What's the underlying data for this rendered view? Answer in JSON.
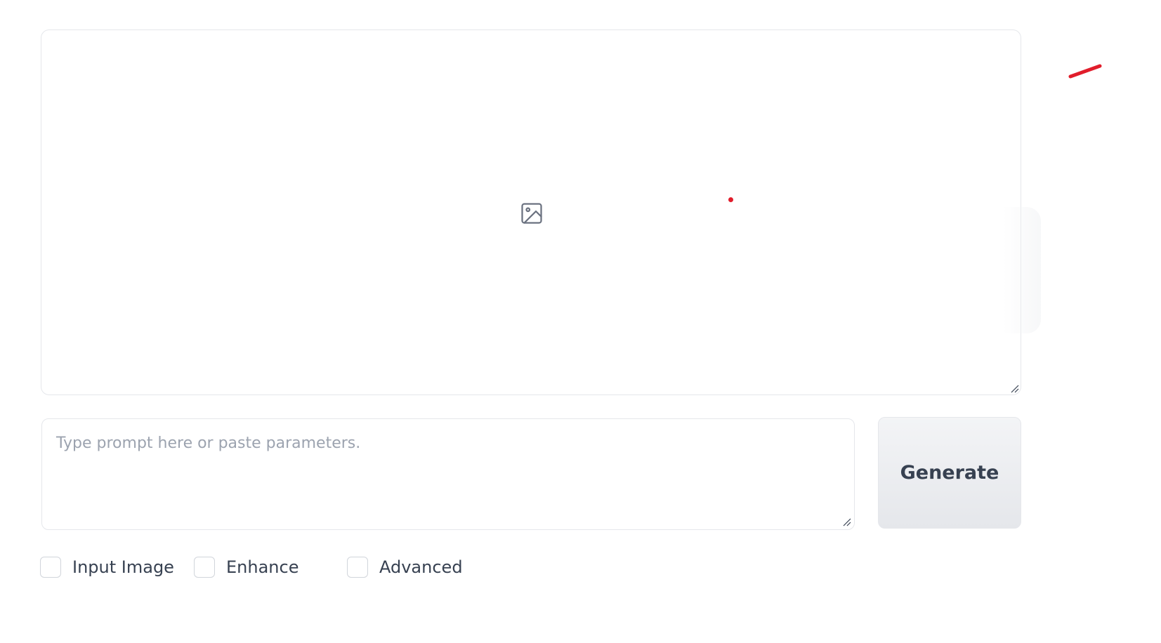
{
  "gallery": {
    "placeholder_icon": "image-icon",
    "resize_icon": "resize-grip-icon"
  },
  "prompt": {
    "value": "",
    "placeholder": "Type prompt here or paste parameters."
  },
  "generate": {
    "label": "Generate"
  },
  "options": [
    {
      "label": "Input Image",
      "checked": false
    },
    {
      "label": "Enhance",
      "checked": false
    },
    {
      "label": "Advanced",
      "checked": false
    }
  ],
  "colors": {
    "annotation_red": "#e11d2b",
    "border": "#e5e7eb",
    "placeholder_text": "#9ca3af",
    "button_bg": "#e5e7eb"
  }
}
